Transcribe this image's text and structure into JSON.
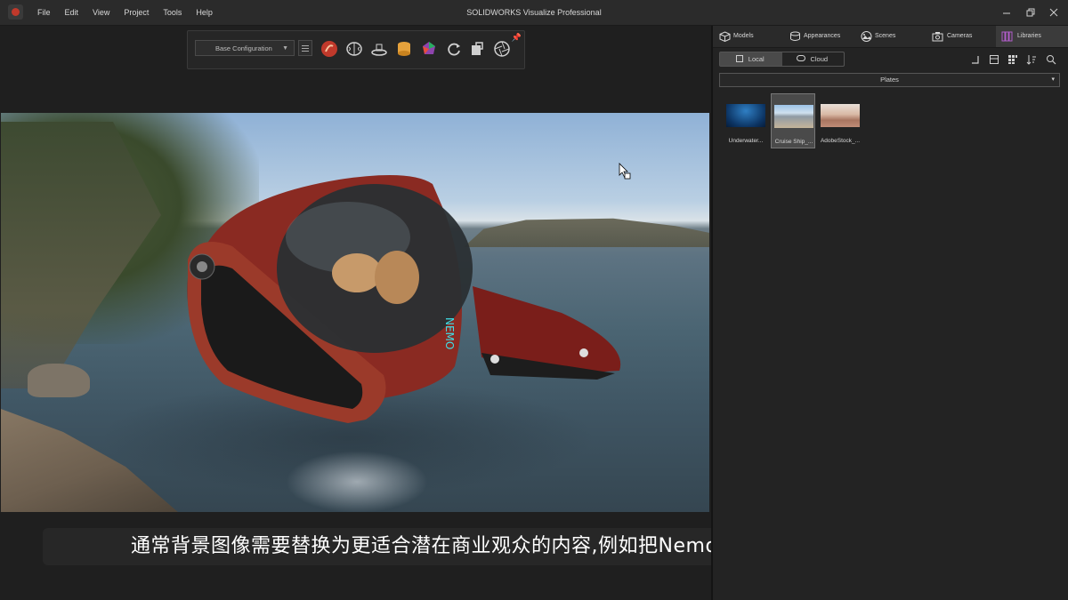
{
  "window": {
    "title": "SOLIDWORKS Visualize Professional",
    "menu": [
      "File",
      "Edit",
      "View",
      "Project",
      "Tools",
      "Help"
    ]
  },
  "toolbar": {
    "configuration": "Base Configuration",
    "tools": [
      "render-icon",
      "brain-icon",
      "turntable-icon",
      "database-icon",
      "color-wheel-icon",
      "refresh-icon",
      "export-icon",
      "aperture-icon"
    ]
  },
  "panel": {
    "tabs": [
      {
        "label": "Models",
        "icon": "cube-icon"
      },
      {
        "label": "Appearances",
        "icon": "cylinder-icon"
      },
      {
        "label": "Scenes",
        "icon": "scene-icon"
      },
      {
        "label": "Cameras",
        "icon": "camera-icon"
      },
      {
        "label": "Libraries",
        "icon": "library-icon",
        "active": true
      }
    ],
    "source": {
      "local": "Local",
      "cloud": "Cloud",
      "selected": "Local"
    },
    "category": "Plates",
    "items": [
      {
        "label": "Underwater..."
      },
      {
        "label": "Cruise Ship_...",
        "selected": true
      },
      {
        "label": "AdobeStock_..."
      }
    ]
  },
  "subtitle": "通常背景图像需要替换为更适合潜在商业观众的内容,例如把Nemo潜水器放置到船舶甲板上",
  "colors": {
    "accent": "#c0392b",
    "libraries_icon": "#b05cc8"
  }
}
